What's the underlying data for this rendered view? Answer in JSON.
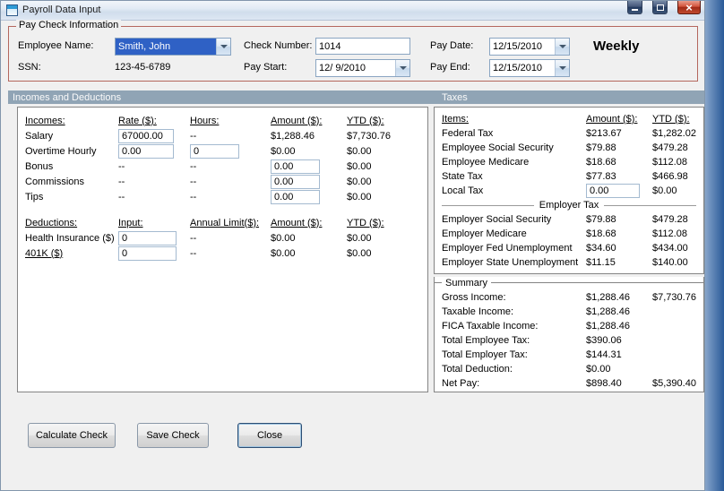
{
  "window": {
    "title": "Payroll Data Input"
  },
  "paycheck": {
    "group_label": "Pay Check Information",
    "employee_name": {
      "label": "Employee Name:",
      "value": "Smith, John"
    },
    "ssn": {
      "label": "SSN:",
      "value": "123-45-6789"
    },
    "check_number": {
      "label": "Check Number:",
      "value": "1014"
    },
    "pay_start": {
      "label": "Pay Start:",
      "value": "12/ 9/2010"
    },
    "pay_date": {
      "label": "Pay Date:",
      "value": "12/15/2010"
    },
    "pay_end": {
      "label": "Pay End:",
      "value": "12/15/2010"
    },
    "frequency": "Weekly"
  },
  "section_headers": {
    "incomes_deductions": "Incomes and Deductions",
    "taxes": "Taxes"
  },
  "incomes": {
    "headers": {
      "name": "Incomes:",
      "rate": "Rate ($):",
      "hours": "Hours:",
      "amount": "Amount ($):",
      "ytd": "YTD ($):"
    },
    "salary": {
      "name": "Salary",
      "rate": "67000.00",
      "hours": "--",
      "amount": "$1,288.46",
      "ytd": "$7,730.76"
    },
    "overtime": {
      "name": "Overtime Hourly",
      "rate": "0.00",
      "hours": "0",
      "amount": "$0.00",
      "ytd": "$0.00"
    },
    "bonus": {
      "name": "Bonus",
      "rate": "--",
      "hours": "--",
      "amount": "0.00",
      "ytd": "$0.00"
    },
    "commissions": {
      "name": "Commissions",
      "rate": "--",
      "hours": "--",
      "amount": "0.00",
      "ytd": "$0.00"
    },
    "tips": {
      "name": "Tips",
      "rate": "--",
      "hours": "--",
      "amount": "0.00",
      "ytd": "$0.00"
    }
  },
  "deductions": {
    "headers": {
      "name": "Deductions:",
      "input": "Input:",
      "annual_limit": "Annual Limit($):",
      "amount": "Amount ($):",
      "ytd": "YTD ($):"
    },
    "health": {
      "name": "Health Insurance ($)",
      "input": "0",
      "annual_limit": "--",
      "amount": "$0.00",
      "ytd": "$0.00"
    },
    "k401": {
      "name": "401K ($)",
      "input": "0",
      "annual_limit": "--",
      "amount": "$0.00",
      "ytd": "$0.00"
    }
  },
  "taxes": {
    "headers": {
      "items": "Items:",
      "amount": "Amount ($):",
      "ytd": "YTD ($):"
    },
    "federal": {
      "name": "Federal Tax",
      "amount": "$213.67",
      "ytd": "$1,282.02"
    },
    "emp_ss": {
      "name": "Employee Social Security",
      "amount": "$79.88",
      "ytd": "$479.28"
    },
    "emp_medicare": {
      "name": "Employee Medicare",
      "amount": "$18.68",
      "ytd": "$112.08"
    },
    "state": {
      "name": "State Tax",
      "amount": "$77.83",
      "ytd": "$466.98"
    },
    "local": {
      "name": "Local Tax",
      "amount": "0.00",
      "ytd": "$0.00"
    },
    "employer_header": "Employer Tax",
    "er_ss": {
      "name": "Employer Social Security",
      "amount": "$79.88",
      "ytd": "$479.28"
    },
    "er_medicare": {
      "name": "Employer Medicare",
      "amount": "$18.68",
      "ytd": "$112.08"
    },
    "er_fed_unemp": {
      "name": "Employer Fed Unemployment",
      "amount": "$34.60",
      "ytd": "$434.00"
    },
    "er_state_unemp": {
      "name": "Employer State Unemployment",
      "amount": "$11.15",
      "ytd": "$140.00"
    }
  },
  "summary": {
    "caption": "Summary",
    "gross": {
      "name": "Gross Income:",
      "amount": "$1,288.46",
      "ytd": "$7,730.76"
    },
    "taxable": {
      "name": "Taxable Income:",
      "amount": "$1,288.46",
      "ytd": ""
    },
    "fica": {
      "name": "FICA Taxable Income:",
      "amount": "$1,288.46",
      "ytd": ""
    },
    "total_employee_tax": {
      "name": "Total Employee Tax:",
      "amount": "$390.06",
      "ytd": ""
    },
    "total_employer_tax": {
      "name": "Total Employer Tax:",
      "amount": "$144.31",
      "ytd": ""
    },
    "total_deduction": {
      "name": "Total Deduction:",
      "amount": "$0.00",
      "ytd": ""
    },
    "net_pay": {
      "name": "Net Pay:",
      "amount": "$898.40",
      "ytd": "$5,390.40"
    }
  },
  "buttons": {
    "calculate": "Calculate Check",
    "save": "Save Check",
    "close": "Close"
  }
}
